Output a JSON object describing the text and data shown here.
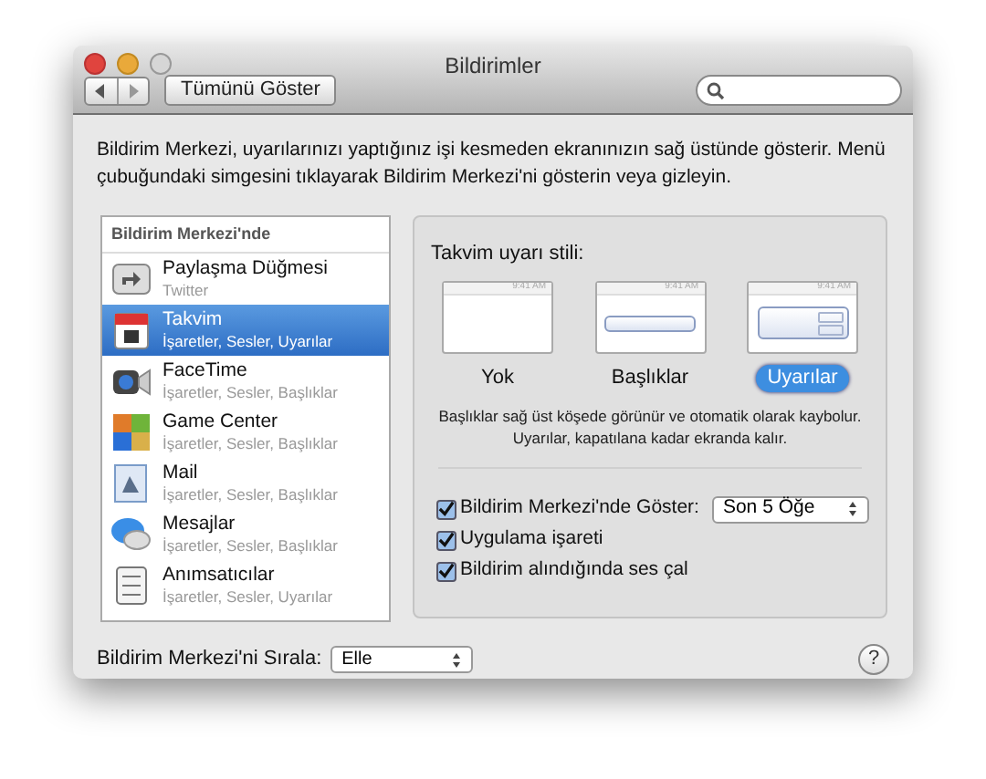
{
  "window": {
    "title": "Bildirimler"
  },
  "toolbar": {
    "show_all": "Tümünü Göster"
  },
  "description": "Bildirim Merkezi, uyarılarınızı yaptığınız işi kesmeden ekranınızın sağ üstünde gösterir. Menü çubuğundaki simgesini tıklayarak Bildirim Merkezi'ni gösterin veya gizleyin.",
  "app_list": {
    "header": "Bildirim Merkezi'nde",
    "items": [
      {
        "name": "Paylaşma Düğmesi",
        "detail": "Twitter",
        "selected": false
      },
      {
        "name": "Takvim",
        "detail": "İşaretler, Sesler, Uyarılar",
        "selected": true
      },
      {
        "name": "FaceTime",
        "detail": "İşaretler, Sesler, Başlıklar",
        "selected": false
      },
      {
        "name": "Game Center",
        "detail": "İşaretler, Sesler, Başlıklar",
        "selected": false
      },
      {
        "name": "Mail",
        "detail": "İşaretler, Sesler, Başlıklar",
        "selected": false
      },
      {
        "name": "Mesajlar",
        "detail": "İşaretler, Sesler, Başlıklar",
        "selected": false
      },
      {
        "name": "Anımsatıcılar",
        "detail": "İşaretler, Sesler, Uyarılar",
        "selected": false
      }
    ]
  },
  "settings": {
    "style_label": "Takvim uyarı stili:",
    "styles": [
      {
        "kind": "none",
        "label": "Yok",
        "clock": "9:41 AM",
        "selected": false
      },
      {
        "kind": "banner",
        "label": "Başlıklar",
        "clock": "9:41 AM",
        "selected": false
      },
      {
        "kind": "alert",
        "label": "Uyarılar",
        "clock": "9:41 AM",
        "selected": true
      }
    ],
    "hint": "Başlıklar sağ üst köşede görünür ve otomatik olarak kaybolur. Uyarılar, kapatılana kadar ekranda kalır.",
    "options": [
      {
        "label": "Bildirim Merkezi'nde Göster:",
        "checked": true,
        "popup": "Son 5 Öğe"
      },
      {
        "label": "Uygulama işareti",
        "checked": true
      },
      {
        "label": "Bildirim alındığında ses çal",
        "checked": true
      }
    ]
  },
  "footer": {
    "sort_label": "Bildirim Merkezi'ni Sırala:",
    "sort_value": "Elle",
    "help": "?"
  }
}
